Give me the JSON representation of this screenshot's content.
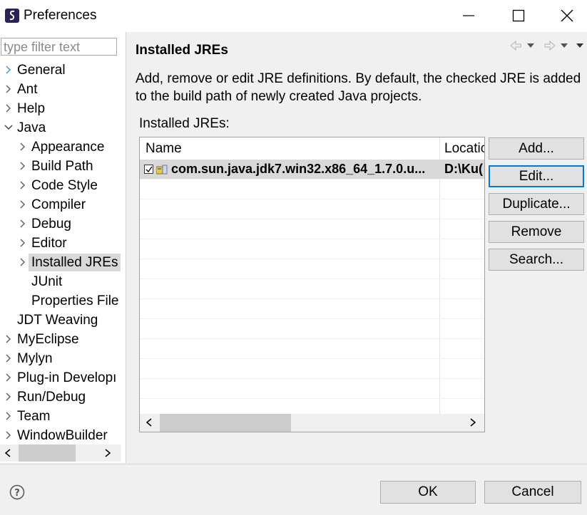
{
  "window": {
    "title": "Preferences",
    "app_icon": "eclipse-s-icon",
    "controls": [
      "minimize-icon",
      "maximize-icon",
      "close-icon"
    ]
  },
  "sidebar": {
    "filter_placeholder": "type filter text",
    "items": [
      {
        "label": "General",
        "level": 0,
        "expander": "collapsed"
      },
      {
        "label": "Ant",
        "level": 0,
        "expander": "collapsed"
      },
      {
        "label": "Help",
        "level": 0,
        "expander": "collapsed"
      },
      {
        "label": "Java",
        "level": 0,
        "expander": "expanded"
      },
      {
        "label": "Appearance",
        "level": 1,
        "expander": "collapsed"
      },
      {
        "label": "Build Path",
        "level": 1,
        "expander": "collapsed"
      },
      {
        "label": "Code Style",
        "level": 1,
        "expander": "collapsed"
      },
      {
        "label": "Compiler",
        "level": 1,
        "expander": "collapsed"
      },
      {
        "label": "Debug",
        "level": 1,
        "expander": "collapsed"
      },
      {
        "label": "Editor",
        "level": 1,
        "expander": "collapsed"
      },
      {
        "label": "Installed JREs",
        "level": 1,
        "expander": "collapsed",
        "selected": true
      },
      {
        "label": "JUnit",
        "level": 1,
        "expander": "none"
      },
      {
        "label": "Properties File",
        "level": 1,
        "expander": "none"
      },
      {
        "label": "JDT Weaving",
        "level": 0,
        "expander": "none"
      },
      {
        "label": "MyEclipse",
        "level": 0,
        "expander": "collapsed"
      },
      {
        "label": "Mylyn",
        "level": 0,
        "expander": "collapsed"
      },
      {
        "label": "Plug-in Developı",
        "level": 0,
        "expander": "collapsed"
      },
      {
        "label": "Run/Debug",
        "level": 0,
        "expander": "collapsed"
      },
      {
        "label": "Team",
        "level": 0,
        "expander": "collapsed"
      },
      {
        "label": "WindowBuilder",
        "level": 0,
        "expander": "collapsed"
      }
    ]
  },
  "main": {
    "heading": "Installed JREs",
    "description": "Add, remove or edit JRE definitions. By default, the checked JRE is added to the build path of newly created Java projects.",
    "table_label": "Installed JREs:",
    "columns": [
      "Name",
      "Locatic"
    ],
    "rows": [
      {
        "name": "com.sun.java.jdk7.win32.x86_64_1.7.0.u...",
        "location": "D:\\Ku(",
        "checked": true,
        "selected": true
      }
    ],
    "buttons": {
      "add": "Add...",
      "edit": "Edit...",
      "duplicate": "Duplicate...",
      "remove": "Remove",
      "search": "Search..."
    }
  },
  "footer": {
    "ok": "OK",
    "cancel": "Cancel"
  },
  "colors": {
    "selection": "#d9d9d9",
    "focus": "#0078d7",
    "expander_collapsed": "#3d9bd6"
  }
}
